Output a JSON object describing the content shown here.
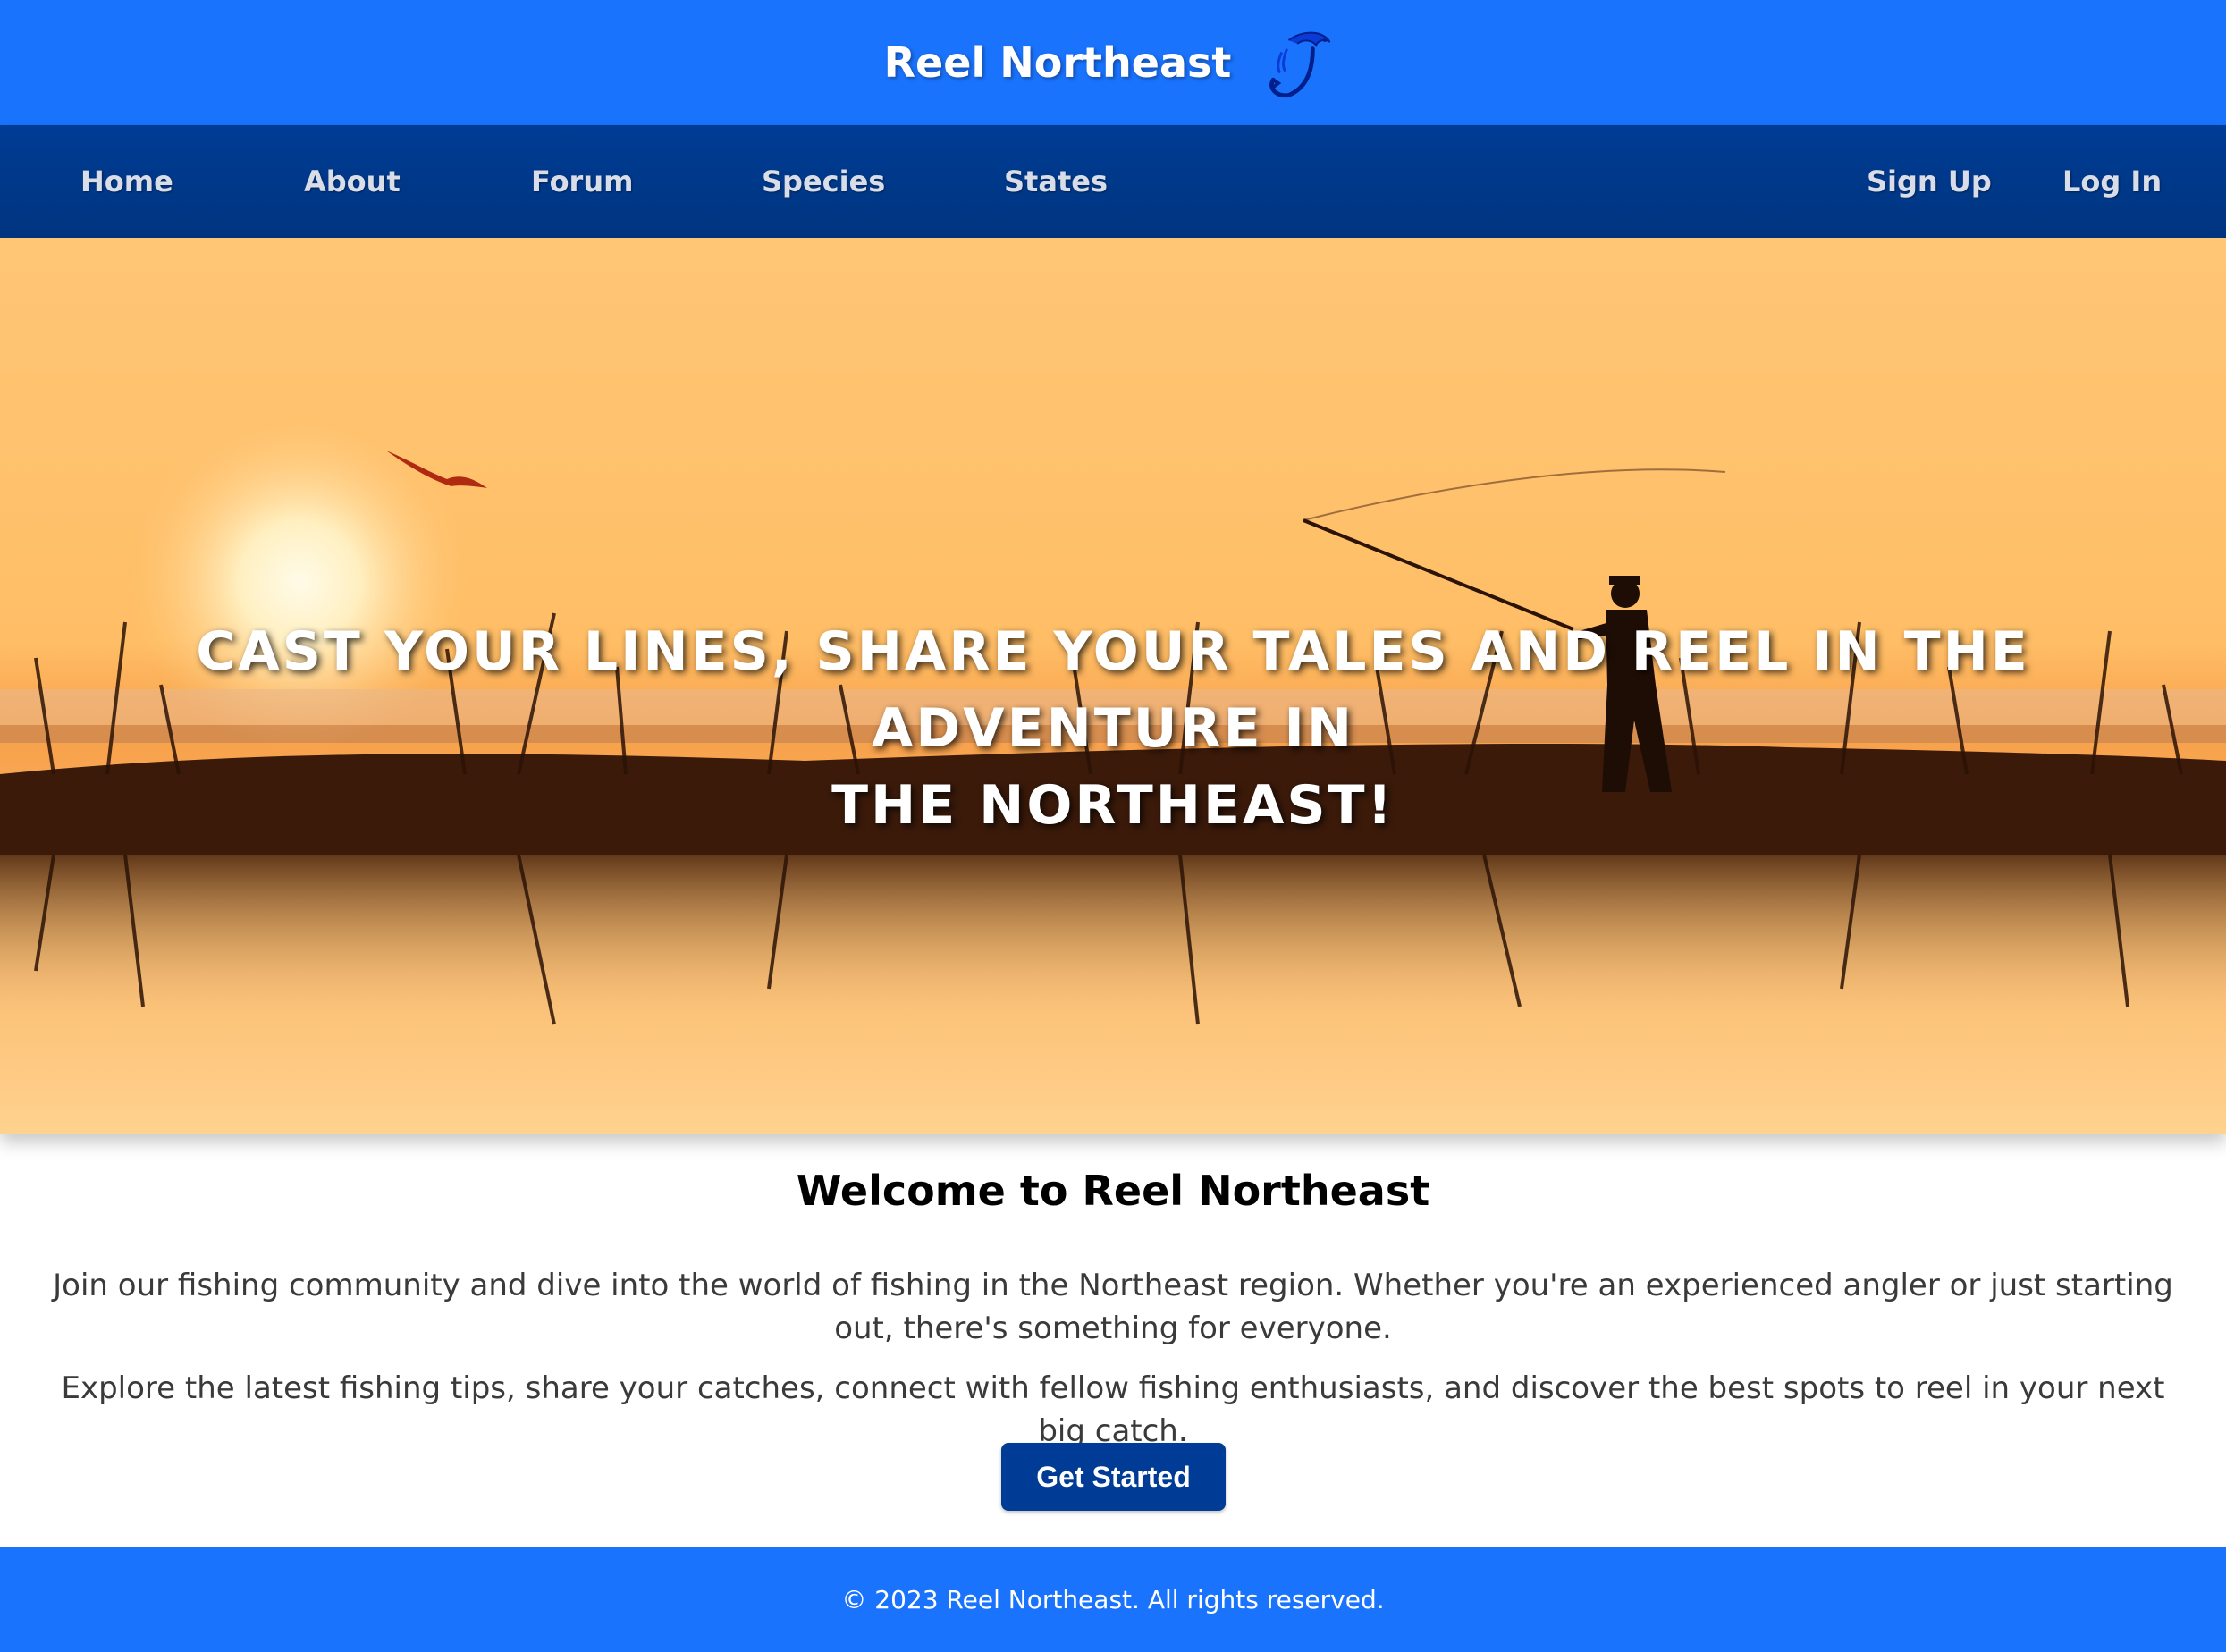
{
  "header": {
    "brand": "Reel Northeast",
    "logo_icon": "fish-hook-icon"
  },
  "nav": {
    "items": [
      {
        "label": "Home"
      },
      {
        "label": "About"
      },
      {
        "label": "Forum"
      },
      {
        "label": "Species"
      },
      {
        "label": "States"
      }
    ],
    "auth": [
      {
        "label": "Sign Up"
      },
      {
        "label": "Log In"
      }
    ]
  },
  "hero": {
    "line1": "CAST YOUR LINES, SHARE YOUR TALES AND REEL IN THE ADVENTURE IN",
    "line2": "THE NORTHEAST!",
    "image": "sunset-fisherman-silhouette"
  },
  "main": {
    "heading": "Welcome to Reel Northeast",
    "paragraph1": "Join our fishing community and dive into the world of fishing in the Northeast region. Whether you're an experienced angler or just starting out, there's something for everyone.",
    "paragraph2": "Explore the latest fishing tips, share your catches, connect with fellow fishing enthusiasts, and discover the best spots to reel in your next big catch.",
    "cta_label": "Get Started"
  },
  "footer": {
    "text": "© 2023 Reel Northeast. All rights reserved."
  },
  "colors": {
    "primary_blue": "#1a73fd",
    "nav_blue": "#003c95",
    "sunset_orange": "#ffc46e"
  }
}
